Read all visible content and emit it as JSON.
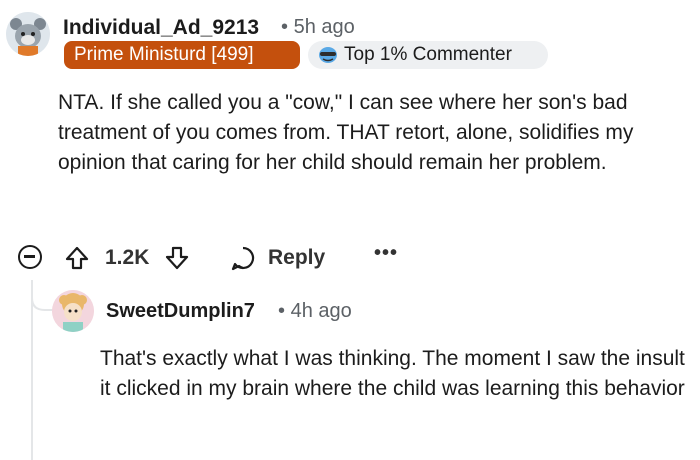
{
  "comment": {
    "author": "Individual_Ad_9213",
    "time": "5h ago",
    "flair": "Prime Ministurd [499]",
    "badge": "Top 1% Commenter",
    "body": "NTA. If she called you a \"cow,\" I can see where her son's bad treatment of you comes from. THAT retort, alone, solidifies my opinion that caring for her child should remain her problem.",
    "score": "1.2K",
    "reply_label": "Reply",
    "more": "•••"
  },
  "reply": {
    "author": "SweetDumplin7",
    "time": "4h ago",
    "body": "That's exactly what I was thinking. The moment I saw the insult it clicked in my brain where the child was learning this behavior"
  },
  "separator": "•"
}
